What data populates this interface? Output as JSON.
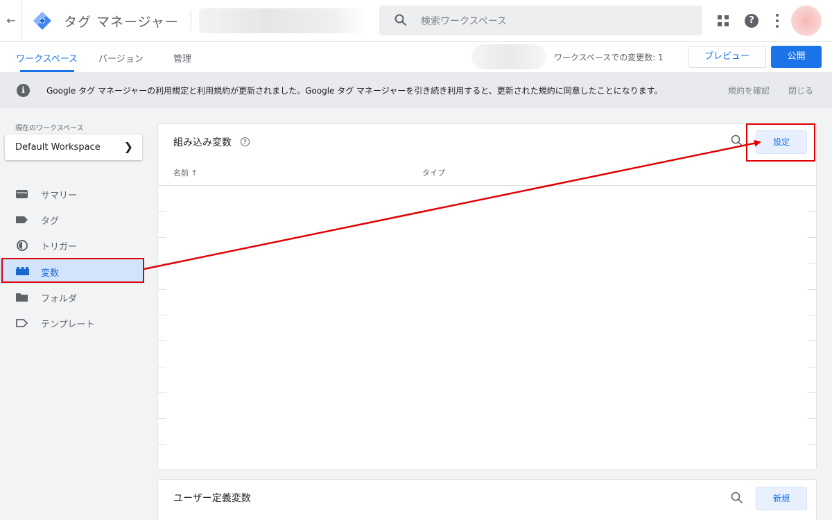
{
  "header": {
    "back_icon": "arrow-left-icon",
    "app_title": "タグ マネージャー",
    "search_placeholder": "検索ワークスペース",
    "icons": [
      "apps-grid-icon",
      "help-icon",
      "more-vert-icon"
    ]
  },
  "subnav": {
    "tabs": [
      {
        "label": "ワークスペース",
        "active": true
      },
      {
        "label": "バージョン",
        "active": false
      },
      {
        "label": "管理",
        "active": false
      }
    ],
    "changes_label": "ワークスペースでの変更数: 1",
    "preview_label": "プレビュー",
    "publish_label": "公開"
  },
  "notice": {
    "text": "Google タグ マネージャーの利用規定と利用規約が更新されました。Google タグ マネージャーを引き続き利用すると、更新された規約に同意したことになります。",
    "confirm_label": "規約を確認",
    "close_label": "閉じる"
  },
  "sidebar": {
    "workspace_label": "現在のワークスペース",
    "workspace_name": "Default Workspace",
    "items": [
      {
        "label": "サマリー",
        "icon": "summary-icon"
      },
      {
        "label": "タグ",
        "icon": "tag-icon"
      },
      {
        "label": "トリガー",
        "icon": "trigger-icon"
      },
      {
        "label": "変数",
        "icon": "variable-icon",
        "active": true
      },
      {
        "label": "フォルダ",
        "icon": "folder-icon"
      },
      {
        "label": "テンプレート",
        "icon": "template-icon"
      }
    ]
  },
  "builtin_vars": {
    "title": "組み込み変数",
    "settings_label": "設定",
    "col_name": "名前 ↑",
    "col_type": "タイプ"
  },
  "user_vars": {
    "title": "ユーザー定義変数",
    "new_label": "新規"
  },
  "colors": {
    "accent": "#1a73e8",
    "annotation": "#e00000",
    "active_nav_bg": "#d2e3fc"
  }
}
